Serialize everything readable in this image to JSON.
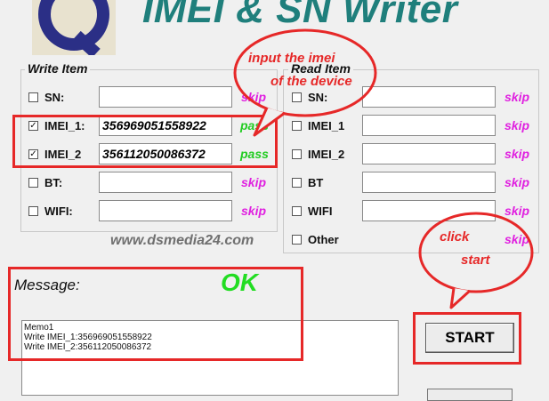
{
  "header": {
    "title": "IMEI & SN Writer",
    "logo_icon": "q-logo-icon"
  },
  "write_group": {
    "title": "Write Item",
    "rows": [
      {
        "label": "SN:",
        "checked": false,
        "value": "",
        "status": "skip"
      },
      {
        "label": "IMEI_1:",
        "checked": true,
        "value": "356969051558922",
        "status": "pass"
      },
      {
        "label": "IMEI_2",
        "checked": true,
        "value": "356112050086372",
        "status": "pass"
      },
      {
        "label": "BT:",
        "checked": false,
        "value": "",
        "status": "skip"
      },
      {
        "label": "WIFI:",
        "checked": false,
        "value": "",
        "status": "skip"
      }
    ]
  },
  "read_group": {
    "title": "Read Item",
    "rows": [
      {
        "label": "SN:",
        "checked": false,
        "value": "",
        "status": "skip"
      },
      {
        "label": "IMEI_1",
        "checked": false,
        "value": "",
        "status": "skip"
      },
      {
        "label": "IMEI_2",
        "checked": false,
        "value": "",
        "status": "skip"
      },
      {
        "label": "BT",
        "checked": false,
        "value": "",
        "status": "skip"
      },
      {
        "label": "WIFI",
        "checked": false,
        "value": "",
        "status": "skip"
      },
      {
        "label": "Other",
        "checked": false,
        "status": "skip"
      }
    ]
  },
  "watermark": "www.dsmedia24.com",
  "message": {
    "label": "Message:",
    "result": "OK",
    "lines": [
      "Memo1",
      "Write IMEI_1:356969051558922",
      "Write IMEI_2:356112050086372"
    ]
  },
  "buttons": {
    "start": "START"
  },
  "annotations": {
    "input_bubble": [
      "input the imei",
      "of the device"
    ],
    "click_bubble": [
      "click",
      "start"
    ]
  },
  "colors": {
    "accent": "#1f7f7c",
    "skip": "#e020e0",
    "pass": "#22cc22",
    "annotation": "#e62828"
  }
}
